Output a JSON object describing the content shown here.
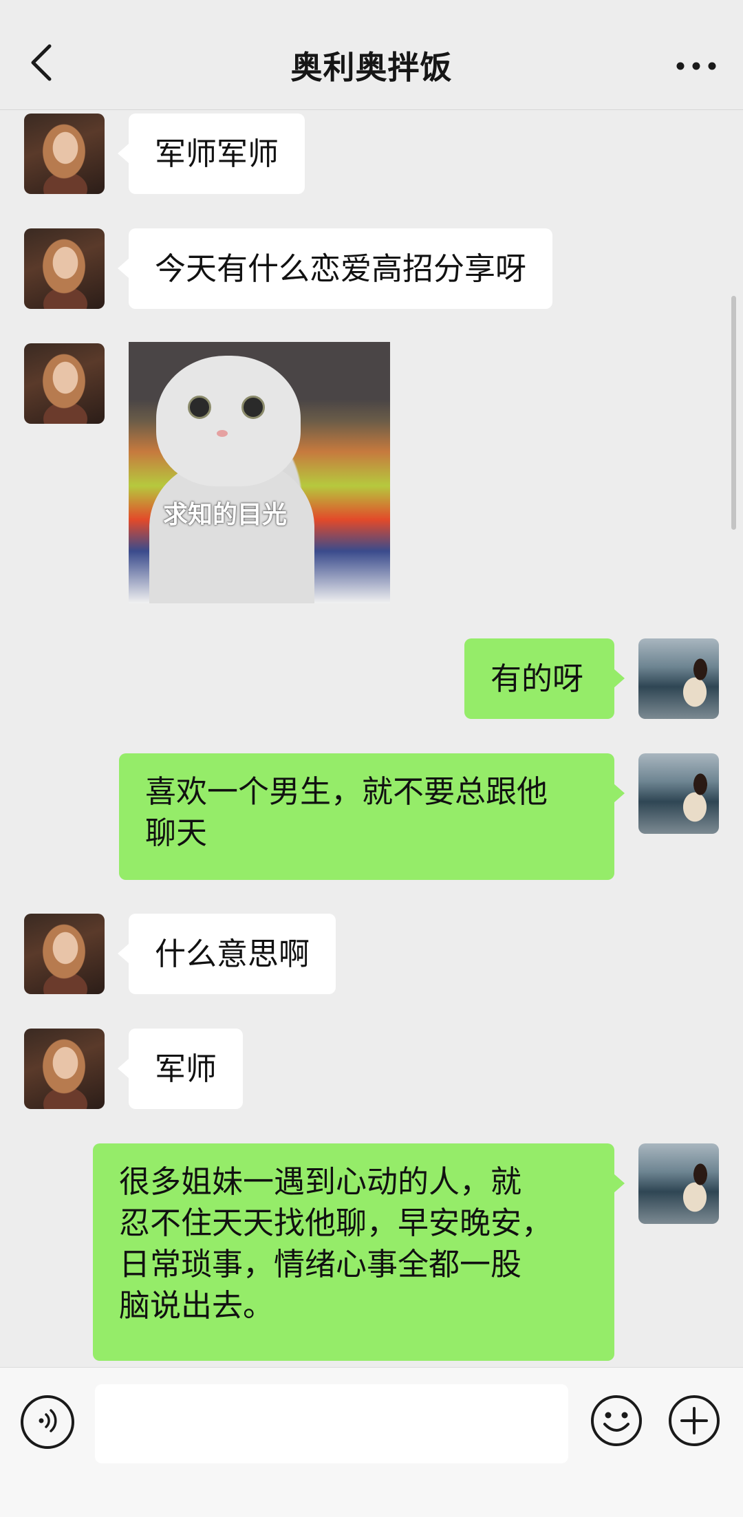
{
  "header": {
    "title": "奥利奥拌饭",
    "back_icon": "chevron-left-icon",
    "more_icon": "more-dots-icon"
  },
  "messages": [
    {
      "side": "left",
      "type": "text",
      "text": "军师军师"
    },
    {
      "side": "left",
      "type": "text",
      "text": "今天有什么恋爱高招分享呀"
    },
    {
      "side": "left",
      "type": "sticker",
      "caption": "求知的目光"
    },
    {
      "side": "right",
      "type": "text",
      "text": "有的呀"
    },
    {
      "side": "right",
      "type": "text",
      "lines": [
        "喜欢一个男生，就不要总跟他",
        "聊天"
      ]
    },
    {
      "side": "left",
      "type": "text",
      "text": "什么意思啊"
    },
    {
      "side": "left",
      "type": "text",
      "text": "军师"
    },
    {
      "side": "right",
      "type": "text",
      "lines": [
        "很多姐妹一遇到心动的人，就",
        "忍不住天天找他聊，早安晚安，",
        "日常琐事，情绪心事全都一股",
        "脑说出去。"
      ]
    }
  ],
  "input_bar": {
    "voice_icon": "voice-icon",
    "input_value": "",
    "emoji_icon": "emoji-icon",
    "plus_icon": "plus-icon"
  },
  "colors": {
    "background": "#ededed",
    "bubble_self": "#95ec69",
    "bubble_other": "#ffffff"
  }
}
